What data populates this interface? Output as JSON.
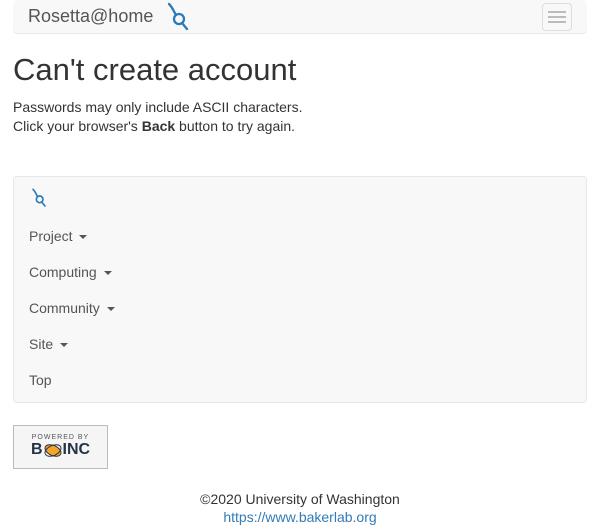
{
  "navbar": {
    "brand_text": "Rosetta@home"
  },
  "page": {
    "title": "Can't create account",
    "error_line1": "Passwords may only include ASCII characters.",
    "error_prefix": "Click your browser's ",
    "error_bold": "Back",
    "error_suffix": " button to try again."
  },
  "footer_nav": {
    "items": [
      {
        "label": "Project",
        "dropdown": true
      },
      {
        "label": "Computing",
        "dropdown": true
      },
      {
        "label": "Community",
        "dropdown": true
      },
      {
        "label": "Site",
        "dropdown": true
      },
      {
        "label": "Top",
        "dropdown": false
      }
    ]
  },
  "boinc": {
    "powered_by": "POWERED BY"
  },
  "footer": {
    "copyright": "©2020 University of Washington",
    "baker_url": "https://www.bakerlab.org"
  }
}
